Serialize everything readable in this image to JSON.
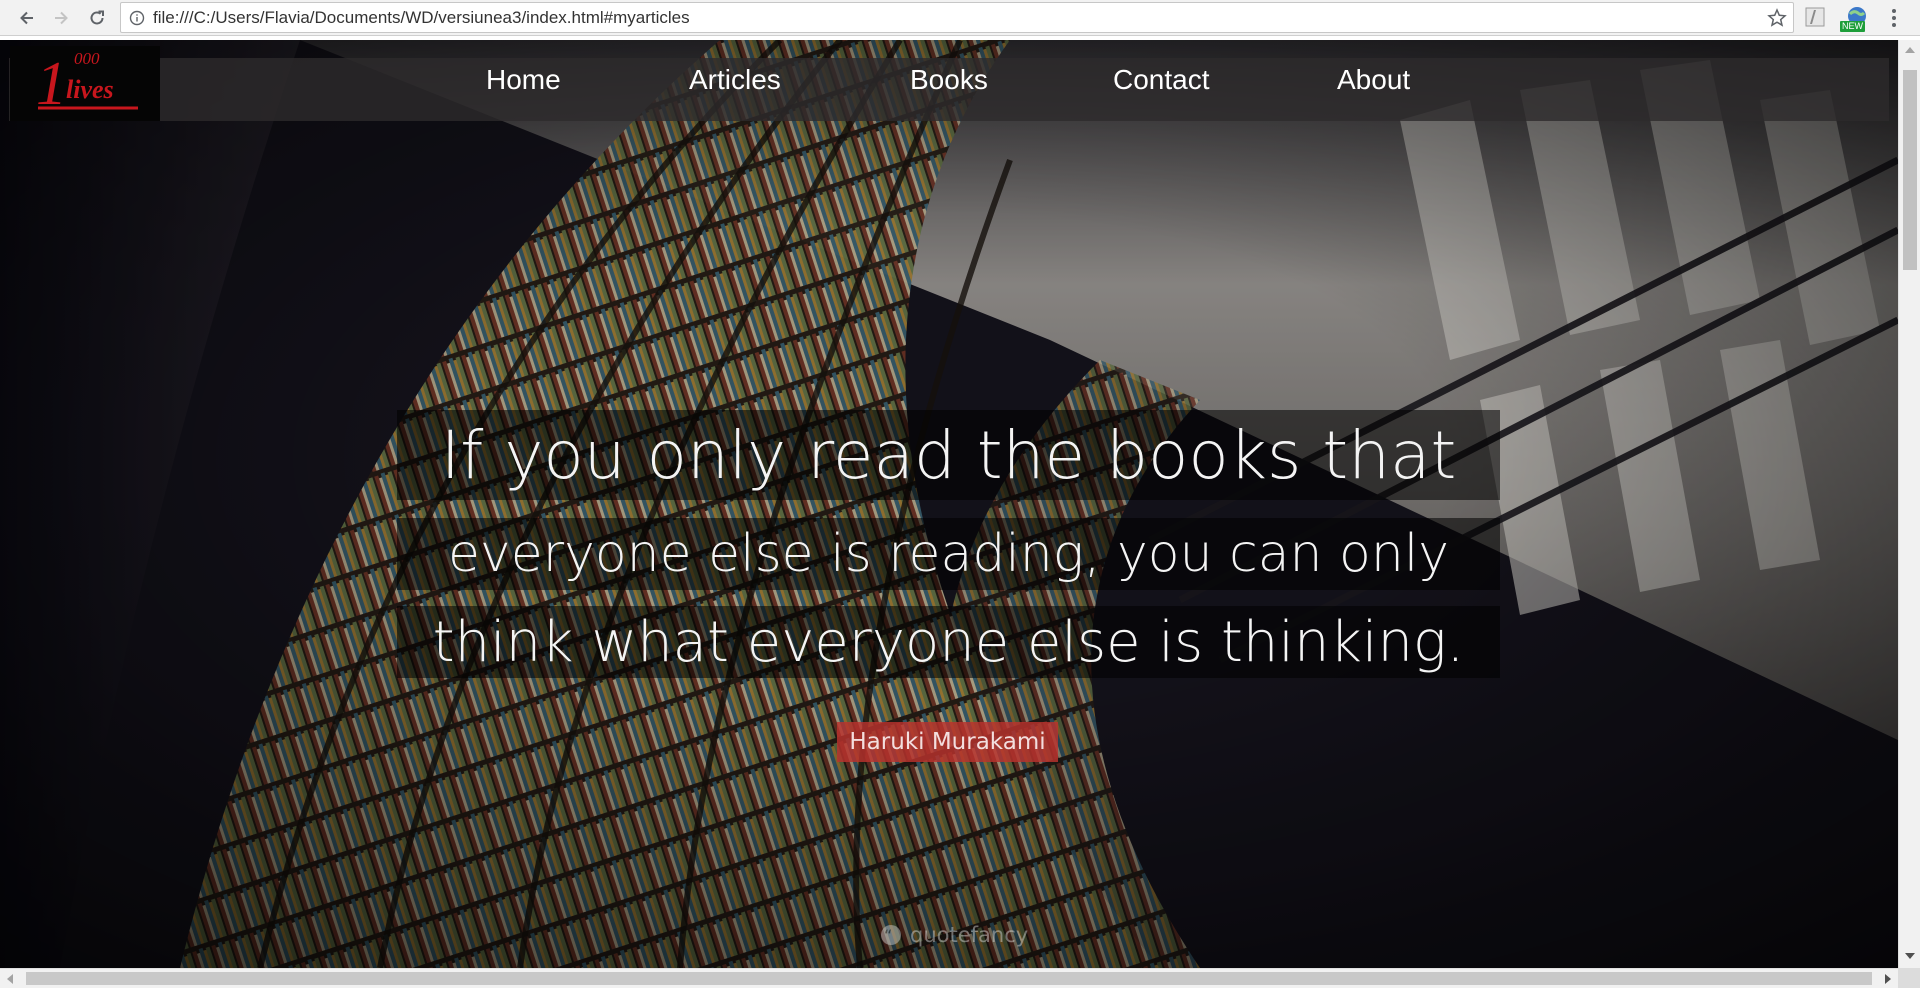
{
  "browser": {
    "url": "file:///C:/Users/Flavia/Documents/WD/versiunea3/index.html#myarticles",
    "extension_badge": "NEW",
    "icons": [
      "back-arrow-icon",
      "forward-arrow-icon",
      "reload-icon",
      "info-icon",
      "star-icon",
      "extension-icon",
      "menu-dots-icon"
    ]
  },
  "site": {
    "logo": {
      "number": "1",
      "small": "000",
      "word": "lives",
      "color": "#c8161d"
    },
    "nav": [
      {
        "label": "Home"
      },
      {
        "label": "Articles"
      },
      {
        "label": "Books"
      },
      {
        "label": "Contact"
      },
      {
        "label": "About"
      }
    ]
  },
  "hero": {
    "quote_lines": [
      "If you only read the books that",
      "everyone else is reading, you can only",
      "think what everyone else is thinking."
    ],
    "author": "Haruki Murakami",
    "watermark": "quotefancy"
  },
  "colors": {
    "nav_background": "#2d2b2c",
    "author_background": "#b9322d",
    "quote_background": "#000000"
  }
}
